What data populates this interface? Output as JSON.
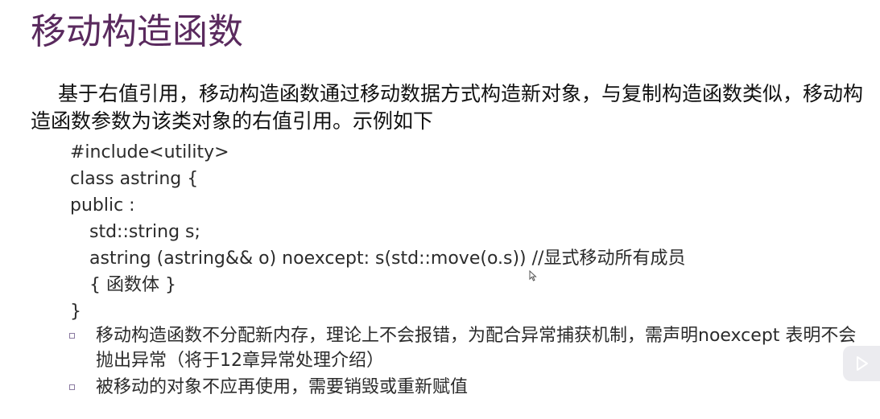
{
  "slide": {
    "title": "移动构造函数",
    "intro": "基于右值引用，移动构造函数通过移动数据方式构造新对象，与复制构造函数类似，移动构造函数参数为该类对象的右值引用。示例如下",
    "code_lines": [
      "#include<utility>",
      "class astring {",
      "public :",
      "std::string s;",
      "astring (astring&& o) noexcept: s(std::move(o.s)) //显式移动所有成员",
      "{ 函数体 }",
      "}"
    ],
    "bullets": [
      "移动构造函数不分配新内存，理论上不会报错，为配合异常捕获机制，需声明noexcept 表明不会抛出异常（将于12章异常处理介绍）",
      "被移动的对象不应再使用，需要销毁或重新赋值"
    ]
  },
  "icons": {
    "bullet": "square-bullet-icon",
    "player": "play-icon",
    "cursor": "mouse-cursor-icon"
  }
}
